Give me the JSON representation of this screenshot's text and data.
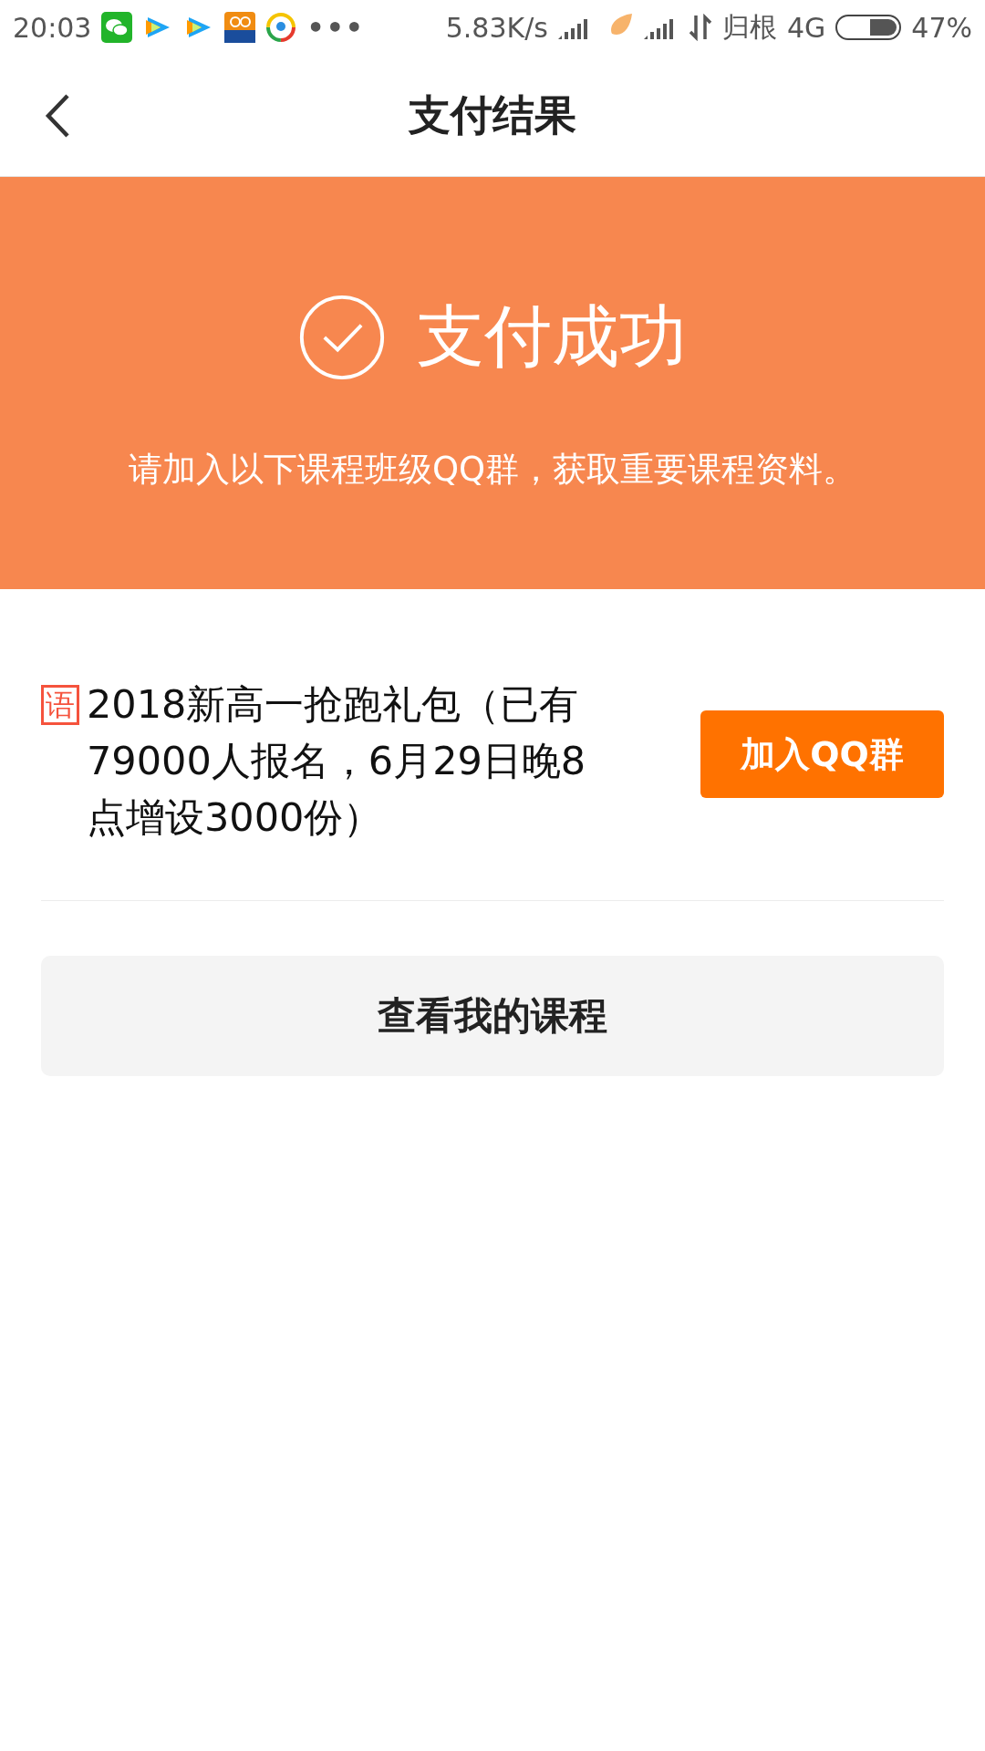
{
  "status_bar": {
    "time": "20:03",
    "more": "•••",
    "network_speed": "5.83K/s",
    "carrier": "归根",
    "network": "4G",
    "battery": "47%"
  },
  "header": {
    "title": "支付结果"
  },
  "banner": {
    "title": "支付成功",
    "message": "请加入以下课程班级QQ群，获取重要课程资料。"
  },
  "courses": [
    {
      "tag": "语",
      "title": "2018新高一抢跑礼包（已有79000人报名，6月29日晚8点增设3000份）",
      "button": "加入QQ群"
    }
  ],
  "my_courses_button": "查看我的课程"
}
